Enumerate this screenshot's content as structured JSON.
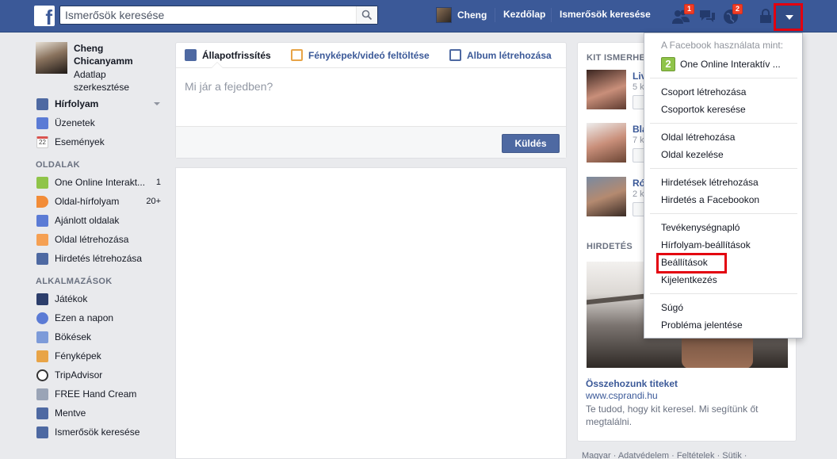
{
  "topbar": {
    "search_placeholder": "Ismerősök keresése",
    "user_name": "Cheng",
    "nav_home": "Kezdőlap",
    "nav_find_friends": "Ismerősök keresése",
    "friend_requests_count": "1",
    "notifications_count": "2"
  },
  "left": {
    "name": "Cheng Chicanyamm",
    "edit_profile": "Adatlap szerkesztése",
    "favorites": [
      {
        "label": "Hírfolyam",
        "icon": "news-feed-icon"
      },
      {
        "label": "Üzenetek",
        "icon": "messages-icon"
      },
      {
        "label": "Események",
        "icon": "events-icon"
      }
    ],
    "pages_header": "OLDALAK",
    "pages": [
      {
        "label": "One Online Interakt...",
        "count": "1"
      },
      {
        "label": "Oldal-hírfolyam",
        "count": "20+"
      },
      {
        "label": "Ajánlott oldalak",
        "count": ""
      },
      {
        "label": "Oldal létrehozása",
        "count": ""
      },
      {
        "label": "Hirdetés létrehozása",
        "count": ""
      }
    ],
    "apps_header": "ALKALMAZÁSOK",
    "apps": [
      {
        "label": "Játékok"
      },
      {
        "label": "Ezen a napon"
      },
      {
        "label": "Bökések"
      },
      {
        "label": "Fényképek"
      },
      {
        "label": "TripAdvisor"
      },
      {
        "label": "FREE Hand Cream"
      },
      {
        "label": "Mentve"
      },
      {
        "label": "Ismerősök keresése"
      }
    ]
  },
  "composer": {
    "tab_status": "Állapotfrissítés",
    "tab_photo": "Fényképek/videó feltöltése",
    "tab_album": "Album létrehozása",
    "placeholder": "Mi jár a fejedben?",
    "post_button": "Küldés"
  },
  "right": {
    "pymk_header": "KIT ISMERHETSZ",
    "people": [
      {
        "name": "Liv",
        "sub": "5 k"
      },
      {
        "name": "Bla",
        "sub": "7 k"
      },
      {
        "name": "Ró",
        "sub": "2 k"
      }
    ],
    "ads_header": "HIRDETÉS",
    "ad": {
      "title": "Összehozunk titeket",
      "url": "www.csprandi.hu",
      "text": "Te tudod, hogy kit keresel. Mi segítünk őt megtalálni."
    },
    "footer": "Magyar · Adatvédelem · Feltételek · Sütik ·"
  },
  "dropdown": {
    "header": "A Facebook használata mint:",
    "account": "One Online Interaktív ...",
    "groups": [
      [
        "Csoport létrehozása",
        "Csoportok keresése"
      ],
      [
        "Oldal létrehozása",
        "Oldal kezelése"
      ],
      [
        "Hirdetések létrehozása",
        "Hirdetés a Facebookon"
      ],
      [
        "Tevékenységnapló",
        "Hírfolyam-beállítások",
        "Beállítások",
        "Kijelentkezés"
      ],
      [
        "Súgó",
        "Probléma jelentése"
      ]
    ]
  },
  "colors": {
    "brand_blue": "#3b5998",
    "highlight_red": "#e3000f",
    "badge_red": "#f03d25"
  }
}
